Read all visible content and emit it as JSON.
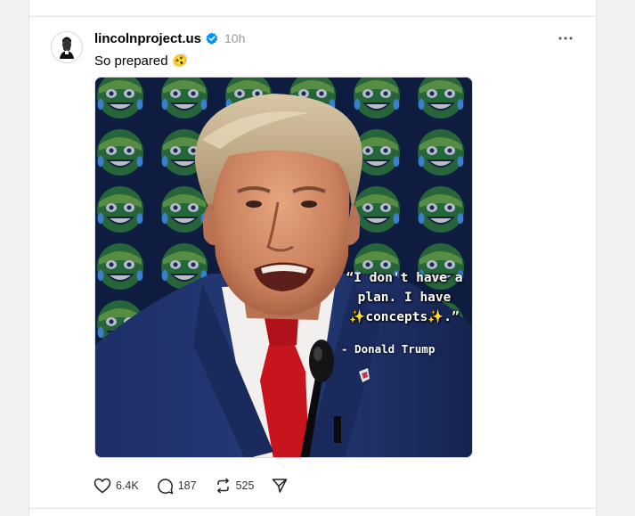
{
  "post": {
    "username": "lincolnproject.us",
    "verified": true,
    "timestamp": "10h",
    "caption": "So prepared",
    "caption_emoji": "🫨",
    "image": {
      "quote_line1": "“I don't have a",
      "quote_line2": "plan. I have",
      "quote_line3_sparkle_left": "✨",
      "quote_line3_text": "concepts",
      "quote_line3_sparkle_right": "✨",
      "quote_line3_end": ".”",
      "attribution": "-  Donald Trump"
    },
    "actions": {
      "likes": "6.4K",
      "replies": "187",
      "reposts": "525"
    }
  },
  "icons": {
    "verified": "verified-badge-icon",
    "more": "more-options-icon",
    "like": "heart-icon",
    "reply": "comment-icon",
    "repost": "repost-icon",
    "share": "share-icon"
  },
  "colors": {
    "verified_blue": "#0095f6",
    "secondary_text": "#999999",
    "image_background": "#0d1c3c"
  }
}
